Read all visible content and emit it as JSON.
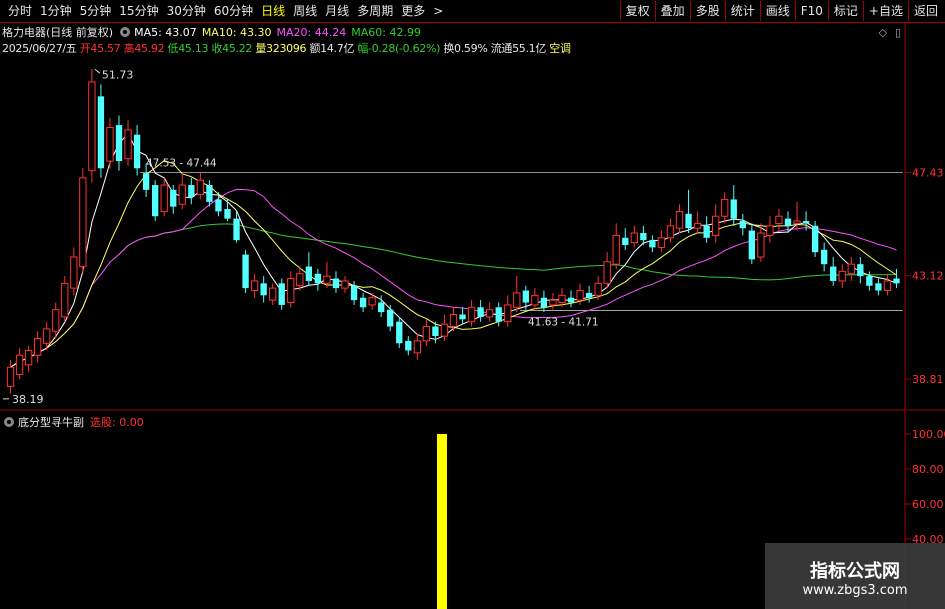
{
  "toolbar": {
    "periods": [
      "分时",
      "1分钟",
      "5分钟",
      "15分钟",
      "30分钟",
      "60分钟",
      "日线",
      "周线",
      "月线",
      "多周期",
      "更多"
    ],
    "active_period": "日线",
    "more_arrow": ">",
    "right_buttons": [
      "复权",
      "叠加",
      "多股",
      "统计",
      "画线",
      "F10",
      "标记",
      "+自选",
      "返回"
    ]
  },
  "header": {
    "stock": "格力电器(日线 前复权)",
    "ma5_label": "MA5: 43.07",
    "ma10_label": "MA10: 43.30",
    "ma20_label": "MA20: 44.24",
    "ma60_label": "MA60: 42.99",
    "date": "2025/06/27/五",
    "open": "开45.57",
    "high": "高45.92",
    "low": "低45.13",
    "close": "收45.22",
    "volume": "量323096",
    "amount": "额14.7亿",
    "change": "幅-0.28(-0.62%)",
    "turnover": "换0.59%",
    "float": "流通55.1亿",
    "trend": "空调",
    "icons": [
      "◇",
      "▯"
    ]
  },
  "colors": {
    "up": "#ff3232",
    "down": "#54ffff",
    "ma5": "#ffffff",
    "ma10": "#ffff66",
    "ma20": "#ff50ff",
    "ma60": "#33cc33",
    "frame": "#a00000",
    "signal": "#ffff00"
  },
  "price_axis": {
    "ticks": [
      "47.43",
      "43.12",
      "38.81"
    ]
  },
  "annotations": {
    "high_label": "51.73",
    "low_label": "38.19",
    "range1": "47.53 - 47.44",
    "range2": "41.63 - 41.71"
  },
  "indicator": {
    "name": "底分型寻牛副",
    "signal_label": "选股: 0.00",
    "ticks": [
      "100.00",
      "80.00",
      "60.00",
      "40.00"
    ],
    "bar_value": 100
  },
  "chart_data": {
    "type": "candlestick",
    "ylim": [
      37.6,
      52.2
    ],
    "candles": [
      {
        "o": 38.5,
        "c": 39.3,
        "h": 39.6,
        "l": 38.2
      },
      {
        "o": 39.0,
        "c": 39.8,
        "h": 40.1,
        "l": 38.8
      },
      {
        "o": 39.4,
        "c": 40.0,
        "h": 40.2,
        "l": 39.1
      },
      {
        "o": 39.8,
        "c": 40.5,
        "h": 40.8,
        "l": 39.5
      },
      {
        "o": 40.3,
        "c": 40.9,
        "h": 41.2,
        "l": 40.0
      },
      {
        "o": 40.8,
        "c": 41.7,
        "h": 42.0,
        "l": 40.5
      },
      {
        "o": 41.4,
        "c": 42.8,
        "h": 43.1,
        "l": 41.2
      },
      {
        "o": 42.6,
        "c": 43.9,
        "h": 44.3,
        "l": 42.3
      },
      {
        "o": 43.5,
        "c": 47.2,
        "h": 47.6,
        "l": 43.2
      },
      {
        "o": 47.5,
        "c": 51.2,
        "h": 51.73,
        "l": 47.0
      },
      {
        "o": 50.6,
        "c": 47.6,
        "h": 51.1,
        "l": 47.2
      },
      {
        "o": 47.9,
        "c": 49.3,
        "h": 49.7,
        "l": 47.6
      },
      {
        "o": 49.4,
        "c": 47.9,
        "h": 49.8,
        "l": 47.5
      },
      {
        "o": 48.0,
        "c": 49.2,
        "h": 49.6,
        "l": 47.7
      },
      {
        "o": 49.0,
        "c": 47.6,
        "h": 49.4,
        "l": 47.3
      },
      {
        "o": 47.4,
        "c": 46.7,
        "h": 47.8,
        "l": 46.4
      },
      {
        "o": 46.9,
        "c": 45.6,
        "h": 47.1,
        "l": 45.4
      },
      {
        "o": 45.8,
        "c": 46.9,
        "h": 47.2,
        "l": 45.6
      },
      {
        "o": 46.7,
        "c": 46.0,
        "h": 46.9,
        "l": 45.7
      },
      {
        "o": 46.1,
        "c": 46.9,
        "h": 47.4,
        "l": 45.9
      },
      {
        "o": 46.9,
        "c": 46.4,
        "h": 47.2,
        "l": 46.1
      },
      {
        "o": 46.5,
        "c": 47.1,
        "h": 47.4,
        "l": 46.3
      },
      {
        "o": 46.9,
        "c": 46.2,
        "h": 47.1,
        "l": 46.0
      },
      {
        "o": 46.3,
        "c": 45.8,
        "h": 46.6,
        "l": 45.6
      },
      {
        "o": 45.9,
        "c": 45.5,
        "h": 46.3,
        "l": 45.4
      },
      {
        "o": 45.5,
        "c": 44.6,
        "h": 45.8,
        "l": 44.5
      },
      {
        "o": 44.0,
        "c": 42.6,
        "h": 44.2,
        "l": 42.4
      },
      {
        "o": 42.5,
        "c": 42.9,
        "h": 43.2,
        "l": 42.2
      },
      {
        "o": 42.8,
        "c": 42.3,
        "h": 43.1,
        "l": 42.0
      },
      {
        "o": 42.1,
        "c": 42.6,
        "h": 42.8,
        "l": 41.9
      },
      {
        "o": 42.8,
        "c": 41.9,
        "h": 43.0,
        "l": 41.7
      },
      {
        "o": 42.0,
        "c": 43.0,
        "h": 43.3,
        "l": 41.8
      },
      {
        "o": 42.7,
        "c": 43.2,
        "h": 43.5,
        "l": 42.5
      },
      {
        "o": 43.5,
        "c": 42.9,
        "h": 44.1,
        "l": 42.7
      },
      {
        "o": 43.2,
        "c": 42.8,
        "h": 43.4,
        "l": 42.5
      },
      {
        "o": 42.8,
        "c": 43.1,
        "h": 43.7,
        "l": 42.6
      },
      {
        "o": 43.0,
        "c": 42.6,
        "h": 43.3,
        "l": 42.4
      },
      {
        "o": 42.6,
        "c": 42.9,
        "h": 43.1,
        "l": 42.4
      },
      {
        "o": 42.7,
        "c": 42.1,
        "h": 42.9,
        "l": 41.9
      },
      {
        "o": 42.2,
        "c": 41.8,
        "h": 42.4,
        "l": 41.6
      },
      {
        "o": 41.9,
        "c": 42.2,
        "h": 42.4,
        "l": 41.7
      },
      {
        "o": 42.0,
        "c": 41.6,
        "h": 42.3,
        "l": 41.4
      },
      {
        "o": 41.7,
        "c": 41.0,
        "h": 41.9,
        "l": 40.8
      },
      {
        "o": 41.2,
        "c": 40.3,
        "h": 41.4,
        "l": 40.1
      },
      {
        "o": 40.4,
        "c": 40.0,
        "h": 40.6,
        "l": 39.8
      },
      {
        "o": 39.9,
        "c": 40.4,
        "h": 40.7,
        "l": 39.6
      },
      {
        "o": 40.4,
        "c": 41.0,
        "h": 41.3,
        "l": 40.2
      },
      {
        "o": 41.0,
        "c": 40.6,
        "h": 41.2,
        "l": 40.3
      },
      {
        "o": 40.6,
        "c": 41.1,
        "h": 41.5,
        "l": 40.4
      },
      {
        "o": 41.0,
        "c": 41.5,
        "h": 41.8,
        "l": 40.8
      },
      {
        "o": 41.5,
        "c": 41.3,
        "h": 41.8,
        "l": 41.1
      },
      {
        "o": 41.2,
        "c": 41.8,
        "h": 42.1,
        "l": 41.0
      },
      {
        "o": 41.8,
        "c": 41.4,
        "h": 42.1,
        "l": 41.2
      },
      {
        "o": 41.4,
        "c": 41.7,
        "h": 42.0,
        "l": 41.2
      },
      {
        "o": 41.8,
        "c": 41.2,
        "h": 42.0,
        "l": 41.0
      },
      {
        "o": 41.2,
        "c": 41.9,
        "h": 42.3,
        "l": 41.0
      },
      {
        "o": 41.8,
        "c": 42.4,
        "h": 43.1,
        "l": 41.6
      },
      {
        "o": 42.5,
        "c": 42.0,
        "h": 42.7,
        "l": 41.7
      },
      {
        "o": 41.9,
        "c": 42.3,
        "h": 42.6,
        "l": 41.7
      },
      {
        "o": 42.2,
        "c": 41.8,
        "h": 42.5,
        "l": 41.6
      },
      {
        "o": 41.9,
        "c": 42.1,
        "h": 42.4,
        "l": 41.7
      },
      {
        "o": 42.0,
        "c": 42.3,
        "h": 42.6,
        "l": 41.8
      },
      {
        "o": 42.2,
        "c": 42.0,
        "h": 42.5,
        "l": 41.8
      },
      {
        "o": 42.1,
        "c": 42.5,
        "h": 42.8,
        "l": 41.9
      },
      {
        "o": 42.4,
        "c": 42.2,
        "h": 42.7,
        "l": 42.0
      },
      {
        "o": 42.3,
        "c": 42.8,
        "h": 43.1,
        "l": 42.1
      },
      {
        "o": 42.8,
        "c": 43.7,
        "h": 44.1,
        "l": 42.6
      },
      {
        "o": 43.6,
        "c": 44.8,
        "h": 45.3,
        "l": 43.4
      },
      {
        "o": 44.7,
        "c": 44.4,
        "h": 45.1,
        "l": 44.2
      },
      {
        "o": 44.5,
        "c": 44.9,
        "h": 45.2,
        "l": 44.3
      },
      {
        "o": 44.9,
        "c": 44.6,
        "h": 45.2,
        "l": 44.4
      },
      {
        "o": 44.6,
        "c": 44.3,
        "h": 44.8,
        "l": 44.1
      },
      {
        "o": 44.3,
        "c": 44.7,
        "h": 45.0,
        "l": 44.1
      },
      {
        "o": 44.7,
        "c": 45.2,
        "h": 45.5,
        "l": 44.5
      },
      {
        "o": 45.1,
        "c": 45.8,
        "h": 46.1,
        "l": 44.9
      },
      {
        "o": 45.7,
        "c": 45.1,
        "h": 46.7,
        "l": 44.9
      },
      {
        "o": 45.1,
        "c": 45.3,
        "h": 45.8,
        "l": 44.9
      },
      {
        "o": 45.2,
        "c": 44.7,
        "h": 45.6,
        "l": 44.5
      },
      {
        "o": 44.8,
        "c": 45.6,
        "h": 46.1,
        "l": 44.5
      },
      {
        "o": 45.6,
        "c": 46.3,
        "h": 46.6,
        "l": 45.3
      },
      {
        "o": 46.3,
        "c": 45.5,
        "h": 46.9,
        "l": 45.2
      },
      {
        "o": 45.4,
        "c": 45.1,
        "h": 45.7,
        "l": 44.8
      },
      {
        "o": 45.0,
        "c": 43.8,
        "h": 45.3,
        "l": 43.6
      },
      {
        "o": 43.9,
        "c": 44.9,
        "h": 45.3,
        "l": 43.7
      },
      {
        "o": 44.8,
        "c": 45.2,
        "h": 45.6,
        "l": 44.5
      },
      {
        "o": 45.3,
        "c": 45.6,
        "h": 45.9,
        "l": 45.0
      },
      {
        "o": 45.5,
        "c": 45.2,
        "h": 45.8,
        "l": 44.9
      },
      {
        "o": 45.3,
        "c": 45.4,
        "h": 46.2,
        "l": 45.0
      },
      {
        "o": 45.4,
        "c": 45.3,
        "h": 45.8,
        "l": 45.0
      },
      {
        "o": 45.2,
        "c": 44.1,
        "h": 45.4,
        "l": 43.9
      },
      {
        "o": 44.2,
        "c": 43.6,
        "h": 44.5,
        "l": 43.3
      },
      {
        "o": 43.5,
        "c": 42.9,
        "h": 43.9,
        "l": 42.7
      },
      {
        "o": 42.9,
        "c": 43.3,
        "h": 43.6,
        "l": 42.6
      },
      {
        "o": 43.2,
        "c": 43.6,
        "h": 43.9,
        "l": 42.9
      },
      {
        "o": 43.6,
        "c": 43.1,
        "h": 43.9,
        "l": 42.8
      },
      {
        "o": 43.1,
        "c": 42.7,
        "h": 43.3,
        "l": 42.5
      },
      {
        "o": 42.8,
        "c": 42.5,
        "h": 43.0,
        "l": 42.3
      },
      {
        "o": 42.5,
        "c": 42.9,
        "h": 43.2,
        "l": 42.3
      },
      {
        "o": 43.0,
        "c": 42.8,
        "h": 43.4,
        "l": 42.6
      }
    ]
  }
}
